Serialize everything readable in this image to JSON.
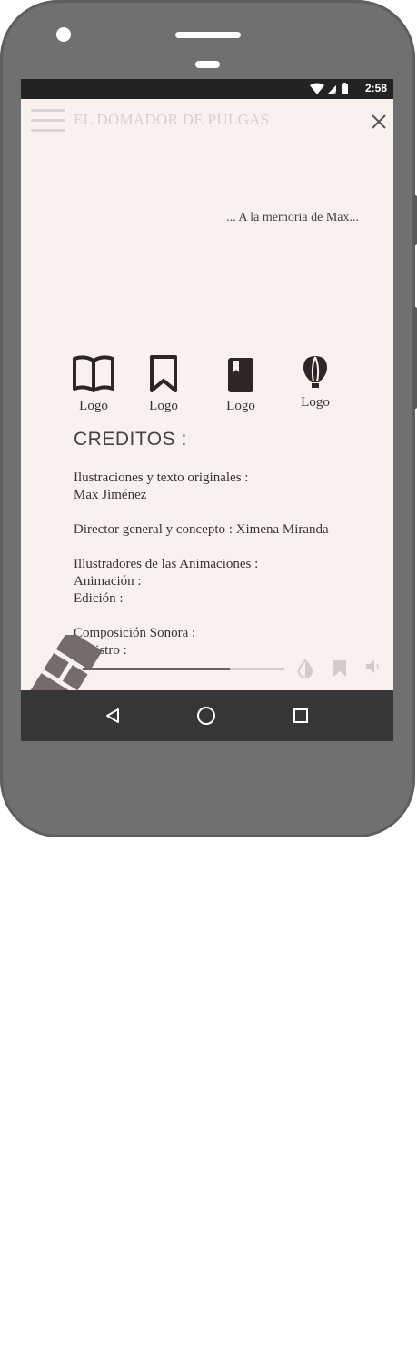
{
  "status_bar": {
    "time": "2:58"
  },
  "header": {
    "title": "EL DOMADOR DE PULGAS"
  },
  "dedication": "... A la memoria de Max...",
  "logos": [
    {
      "icon": "book-open-icon",
      "label": "Logo"
    },
    {
      "icon": "bookmark-icon",
      "label": "Logo"
    },
    {
      "icon": "book-icon",
      "label": "Logo"
    },
    {
      "icon": "balloon-icon",
      "label": "Logo"
    }
  ],
  "credits": {
    "heading": "CREDITOS :",
    "lines": [
      "Ilustraciones y texto originales :",
      "Max Jiménez",
      "",
      "Director general y concepto : Ximena Miranda",
      "",
      "Illustradores de las Animaciones :",
      "Animación :",
      "Edición :",
      "",
      "Composición Sonora :",
      "Registro :"
    ]
  },
  "player": {
    "progress": 0.73
  },
  "colors": {
    "screen_bg": "#faf1ee",
    "text": "#3a3232",
    "title": "#d8cfcd",
    "nav_bg": "#363636"
  }
}
